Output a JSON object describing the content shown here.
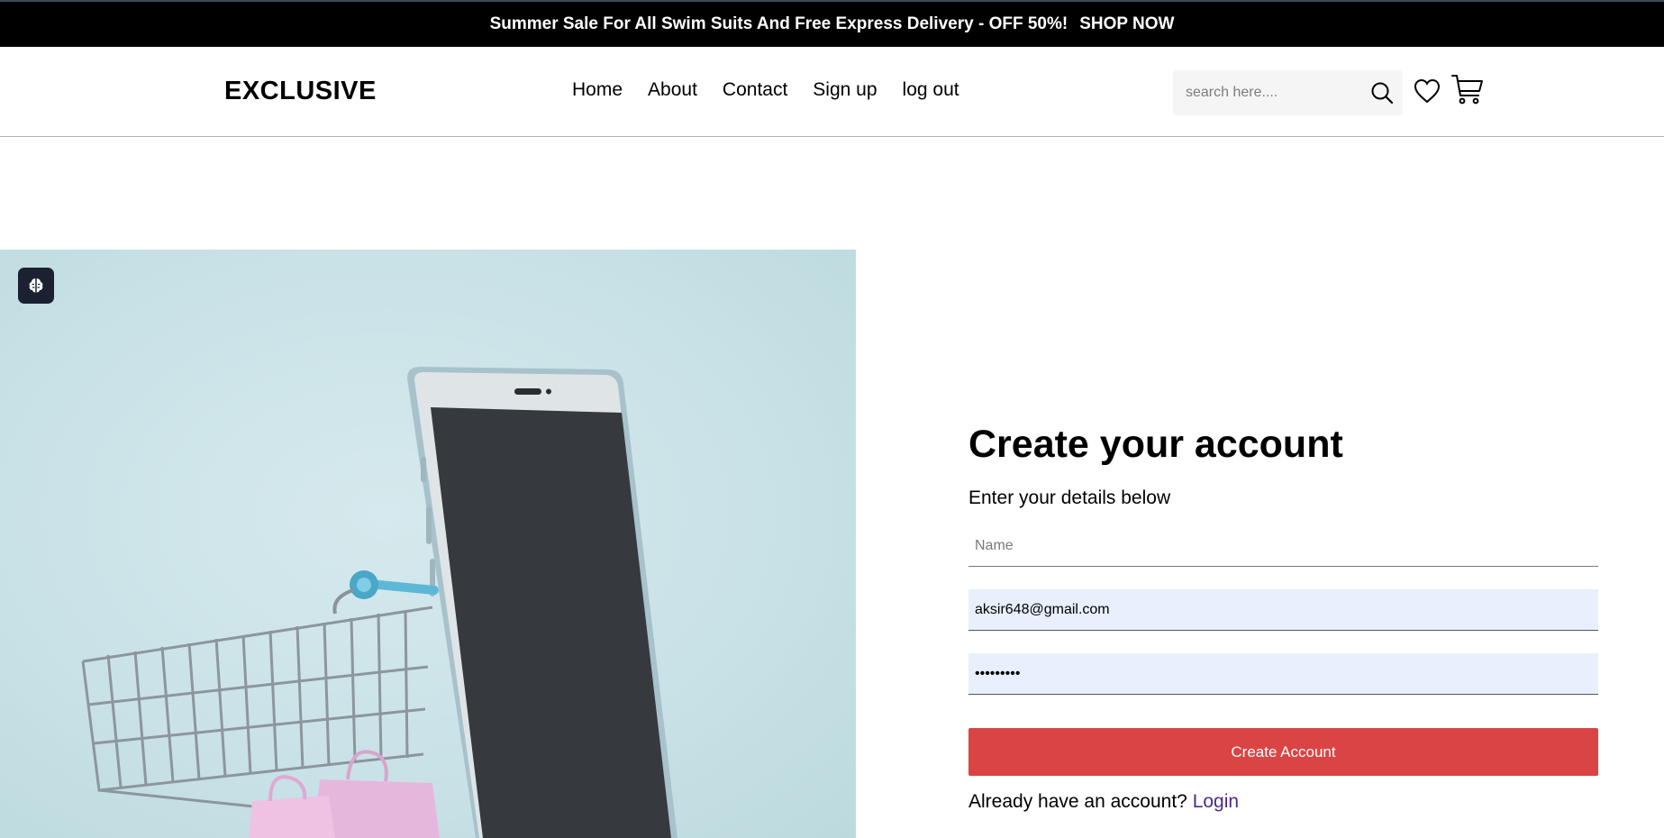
{
  "topbar": {
    "announcement": "Summer Sale For All Swim Suits And Free Express Delivery - OFF 50%!",
    "shop_now": "SHOP NOW"
  },
  "header": {
    "logo": "EXCLUSIVE",
    "nav": [
      {
        "label": "Home"
      },
      {
        "label": "About"
      },
      {
        "label": "Contact"
      },
      {
        "label": "Sign up"
      },
      {
        "label": "log out"
      }
    ],
    "search_placeholder": "search here....",
    "icons": [
      "search-icon",
      "heart-icon",
      "cart-icon"
    ]
  },
  "hero": {
    "widget_icon": "brain-icon"
  },
  "form": {
    "title": "Create your account",
    "subtitle": "Enter your details below",
    "name_placeholder": "Name",
    "email_value": "aksir648@gmail.com",
    "password_value": "•••••••••",
    "submit_label": "Create Account",
    "already_text": "Already have an account?",
    "login_link": "Login"
  },
  "colors": {
    "accent": "#db4444",
    "autofill": "#e8f0fe",
    "topbar": "#000000",
    "hero_bg": "#c9e2e7",
    "link": "#4b2a8a"
  }
}
